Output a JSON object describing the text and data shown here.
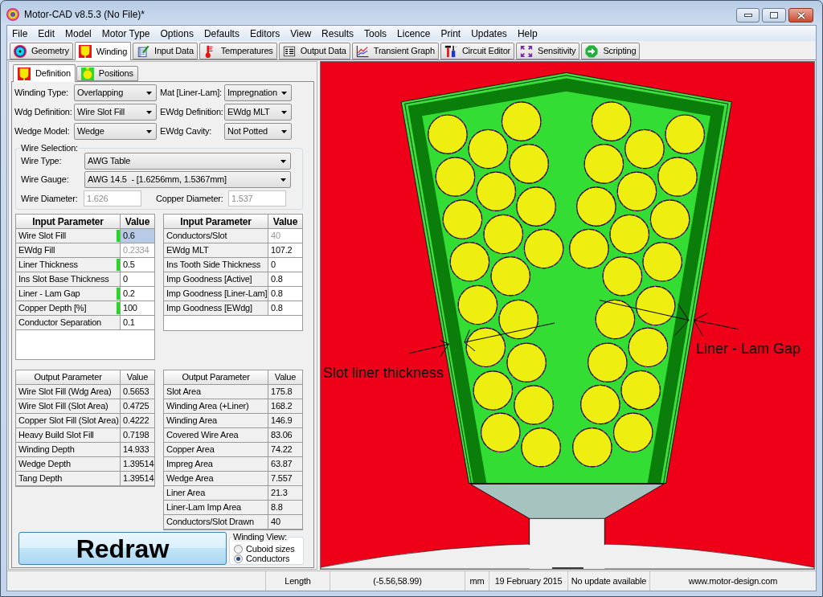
{
  "window": {
    "title": "Motor-CAD v8.5.3 (No File)*"
  },
  "menu": [
    "File",
    "Edit",
    "Model",
    "Motor Type",
    "Options",
    "Defaults",
    "Editors",
    "View",
    "Results",
    "Tools",
    "Licence",
    "Print",
    "Updates",
    "Help"
  ],
  "tabs": [
    {
      "label": "Geometry",
      "selected": false
    },
    {
      "label": "Winding",
      "selected": true
    },
    {
      "label": "Input Data",
      "selected": false
    },
    {
      "label": "Temperatures",
      "selected": false
    },
    {
      "label": "Output Data",
      "selected": false
    },
    {
      "label": "Transient Graph",
      "selected": false
    },
    {
      "label": "Circuit Editor",
      "selected": false
    },
    {
      "label": "Sensitivity",
      "selected": false
    },
    {
      "label": "Scripting",
      "selected": false
    }
  ],
  "subtabs": [
    {
      "label": "Definition",
      "selected": true
    },
    {
      "label": "Positions",
      "selected": false
    }
  ],
  "definition": {
    "dropdowns": [
      {
        "label": "Winding Type:",
        "value": "Overlapping"
      },
      {
        "label": "Mat [Liner-Lam]:",
        "value": "Impregnation"
      },
      {
        "label": "Wdg Definition:",
        "value": "Wire Slot Fill"
      },
      {
        "label": "EWdg Definition:",
        "value": "EWdg MLT"
      },
      {
        "label": "Wedge Model:",
        "value": "Wedge"
      },
      {
        "label": "EWdg Cavity:",
        "value": "Not Potted"
      }
    ],
    "wire_selection": {
      "title": "Wire Selection:",
      "dropdowns": [
        {
          "label": "Wire Type:",
          "value": "AWG Table"
        },
        {
          "label": "Wire Gauge:",
          "value": "AWG 14.5  - [1.6256mm, 1.5367mm]"
        }
      ],
      "fields": [
        {
          "label": "Wire Diameter:",
          "value": "1.626",
          "disabled": true
        },
        {
          "label": "Copper Diameter:",
          "value": "1.537",
          "disabled": true
        }
      ]
    }
  },
  "input_tables": [
    {
      "columns": [
        "Input Parameter",
        "Value"
      ],
      "rows": [
        {
          "parameter": "Wire Slot Fill",
          "value": "0.6",
          "marked": true,
          "disabled": false,
          "selected": true
        },
        {
          "parameter": "EWdg Fill",
          "value": "0.2334",
          "marked": false,
          "disabled": true,
          "selected": false
        },
        {
          "parameter": "Liner Thickness",
          "value": "0.5",
          "marked": true,
          "disabled": false,
          "selected": false
        },
        {
          "parameter": "Ins Slot Base Thickness",
          "value": "0",
          "marked": false,
          "disabled": false,
          "selected": false
        },
        {
          "parameter": "Liner - Lam Gap",
          "value": "0.2",
          "marked": true,
          "disabled": false,
          "selected": false
        },
        {
          "parameter": "Copper Depth [%]",
          "value": "100",
          "marked": true,
          "disabled": false,
          "selected": false
        },
        {
          "parameter": "Conductor Separation",
          "value": "0.1",
          "marked": false,
          "disabled": false,
          "selected": false
        }
      ]
    },
    {
      "columns": [
        "Input Parameter",
        "Value"
      ],
      "rows": [
        {
          "parameter": "Conductors/Slot",
          "value": "40",
          "marked": false,
          "disabled": true,
          "selected": false
        },
        {
          "parameter": "EWdg MLT",
          "value": "107.2",
          "marked": false,
          "disabled": false,
          "selected": false
        },
        {
          "parameter": "Ins Tooth Side Thickness",
          "value": "0",
          "marked": false,
          "disabled": false,
          "selected": false
        },
        {
          "parameter": "Imp Goodness [Active]",
          "value": "0.8",
          "marked": false,
          "disabled": false,
          "selected": false
        },
        {
          "parameter": "Imp Goodness [Liner-Lam]",
          "value": "0.8",
          "marked": false,
          "disabled": false,
          "selected": false
        },
        {
          "parameter": "Imp Goodness [EWdg]",
          "value": "0.8",
          "marked": false,
          "disabled": false,
          "selected": false
        }
      ]
    }
  ],
  "output_tables": [
    {
      "columns": [
        "Output Parameter",
        "Value"
      ],
      "rows": [
        {
          "parameter": "Wire Slot Fill (Wdg Area)",
          "value": "0.5653"
        },
        {
          "parameter": "Wire Slot Fill (Slot Area)",
          "value": "0.4725"
        },
        {
          "parameter": "Copper Slot Fill (Slot Area)",
          "value": "0.4222"
        },
        {
          "parameter": "Heavy Build Slot Fill",
          "value": "0.7198"
        },
        {
          "parameter": "Winding Depth",
          "value": "14.933"
        },
        {
          "parameter": "Wedge Depth",
          "value": "1.39514"
        },
        {
          "parameter": "Tang Depth",
          "value": "1.39514"
        }
      ]
    },
    {
      "columns": [
        "Output Parameter",
        "Value"
      ],
      "rows": [
        {
          "parameter": "Slot Area",
          "value": "175.8"
        },
        {
          "parameter": "Winding Area (+Liner)",
          "value": "168.2"
        },
        {
          "parameter": "Winding Area",
          "value": "146.9"
        },
        {
          "parameter": "Covered Wire Area",
          "value": "83.06"
        },
        {
          "parameter": "Copper Area",
          "value": "74.22"
        },
        {
          "parameter": "Impreg Area",
          "value": "63.87"
        },
        {
          "parameter": "Wedge Area",
          "value": "7.557"
        },
        {
          "parameter": "Liner Area",
          "value": "21.3"
        },
        {
          "parameter": "Liner-Lam Imp Area",
          "value": "8.8"
        },
        {
          "parameter": "Conductors/Slot Drawn",
          "value": "40"
        }
      ]
    }
  ],
  "redraw_button": {
    "label": "Redraw"
  },
  "winding_view": {
    "title": "Winding View:",
    "options": [
      {
        "label": "Cuboid sizes",
        "selected": false
      },
      {
        "label": "Conductors",
        "selected": true
      }
    ]
  },
  "drawing": {
    "annotations": [
      {
        "text": "Slot liner thickness"
      },
      {
        "text": "Liner - Lam Gap"
      }
    ]
  },
  "status_bar": [
    "Length",
    "(-5.56,58.99)",
    "mm",
    "19 February 2015",
    "No update available",
    "www.motor-design.com"
  ]
}
